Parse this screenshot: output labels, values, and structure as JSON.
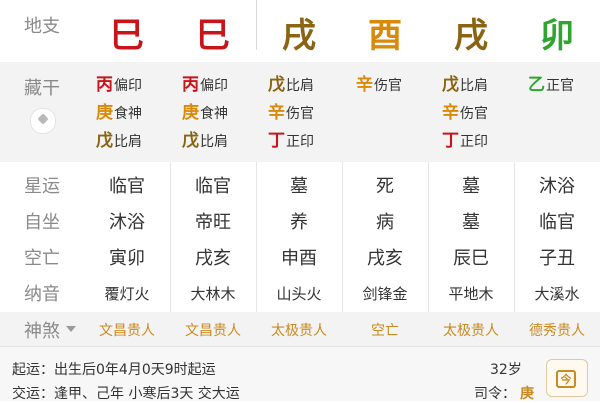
{
  "colors": {
    "fire": "#c8151b",
    "earth": "#8a6412",
    "metal": "#d98a0a",
    "wood": "#2fa52f",
    "label": "#8a8a8a",
    "gold": "#c98a21"
  },
  "branch_row": {
    "label": "地支",
    "chars": [
      {
        "text": "巳",
        "color": "#c8151b"
      },
      {
        "text": "巳",
        "color": "#c8151b"
      },
      {
        "text": "戌",
        "color": "#8a6412"
      },
      {
        "text": "酉",
        "color": "#d98a0a"
      },
      {
        "text": "戌",
        "color": "#8a6412"
      },
      {
        "text": "卯",
        "color": "#2fa52f"
      }
    ]
  },
  "hidden_row": {
    "label": "藏干",
    "pin_icon": "pin-icon",
    "columns": [
      [
        {
          "stem": "丙",
          "color": "#c8151b",
          "god": "偏印"
        },
        {
          "stem": "庚",
          "color": "#d98a0a",
          "god": "食神"
        },
        {
          "stem": "戊",
          "color": "#8a6412",
          "god": "比肩"
        }
      ],
      [
        {
          "stem": "丙",
          "color": "#c8151b",
          "god": "偏印"
        },
        {
          "stem": "庚",
          "color": "#d98a0a",
          "god": "食神"
        },
        {
          "stem": "戊",
          "color": "#8a6412",
          "god": "比肩"
        }
      ],
      [
        {
          "stem": "戊",
          "color": "#8a6412",
          "god": "比肩"
        },
        {
          "stem": "辛",
          "color": "#d98a0a",
          "god": "伤官"
        },
        {
          "stem": "丁",
          "color": "#c8151b",
          "god": "正印"
        }
      ],
      [
        {
          "stem": "辛",
          "color": "#d98a0a",
          "god": "伤官"
        }
      ],
      [
        {
          "stem": "戊",
          "color": "#8a6412",
          "god": "比肩"
        },
        {
          "stem": "辛",
          "color": "#d98a0a",
          "god": "伤官"
        },
        {
          "stem": "丁",
          "color": "#c8151b",
          "god": "正印"
        }
      ],
      [
        {
          "stem": "乙",
          "color": "#2fa52f",
          "god": "正官"
        }
      ]
    ]
  },
  "table": {
    "rows": [
      {
        "label": "星运",
        "cells": [
          "临官",
          "临官",
          "墓",
          "死",
          "墓",
          "沐浴"
        ]
      },
      {
        "label": "自坐",
        "cells": [
          "沐浴",
          "帝旺",
          "养",
          "病",
          "墓",
          "临官"
        ]
      },
      {
        "label": "空亡",
        "cells": [
          "寅卯",
          "戌亥",
          "申酉",
          "戌亥",
          "辰巳",
          "子丑"
        ]
      },
      {
        "label": "纳音",
        "cells": [
          "覆灯火",
          "大林木",
          "山头火",
          "剑锋金",
          "平地木",
          "大溪水"
        ]
      }
    ]
  },
  "shensha": {
    "label": "神煞",
    "dropdown_icon": "chevron-down-icon",
    "cells": [
      "文昌贵人",
      "文昌贵人",
      "太极贵人",
      "空亡",
      "太极贵人",
      "德秀贵人"
    ]
  },
  "info": {
    "qiyun_label": "起运：",
    "qiyun_text": "出生后0年4月0天9时起运",
    "jiaoyun_label": "交运：",
    "jiaoyun_text": "逢甲、己年 小寒后3天 交大运",
    "age": "32岁",
    "siling_label": "司令：",
    "siling_value": "庚",
    "calendar_icon": "calendar-icon",
    "calendar_glyph": "今"
  }
}
